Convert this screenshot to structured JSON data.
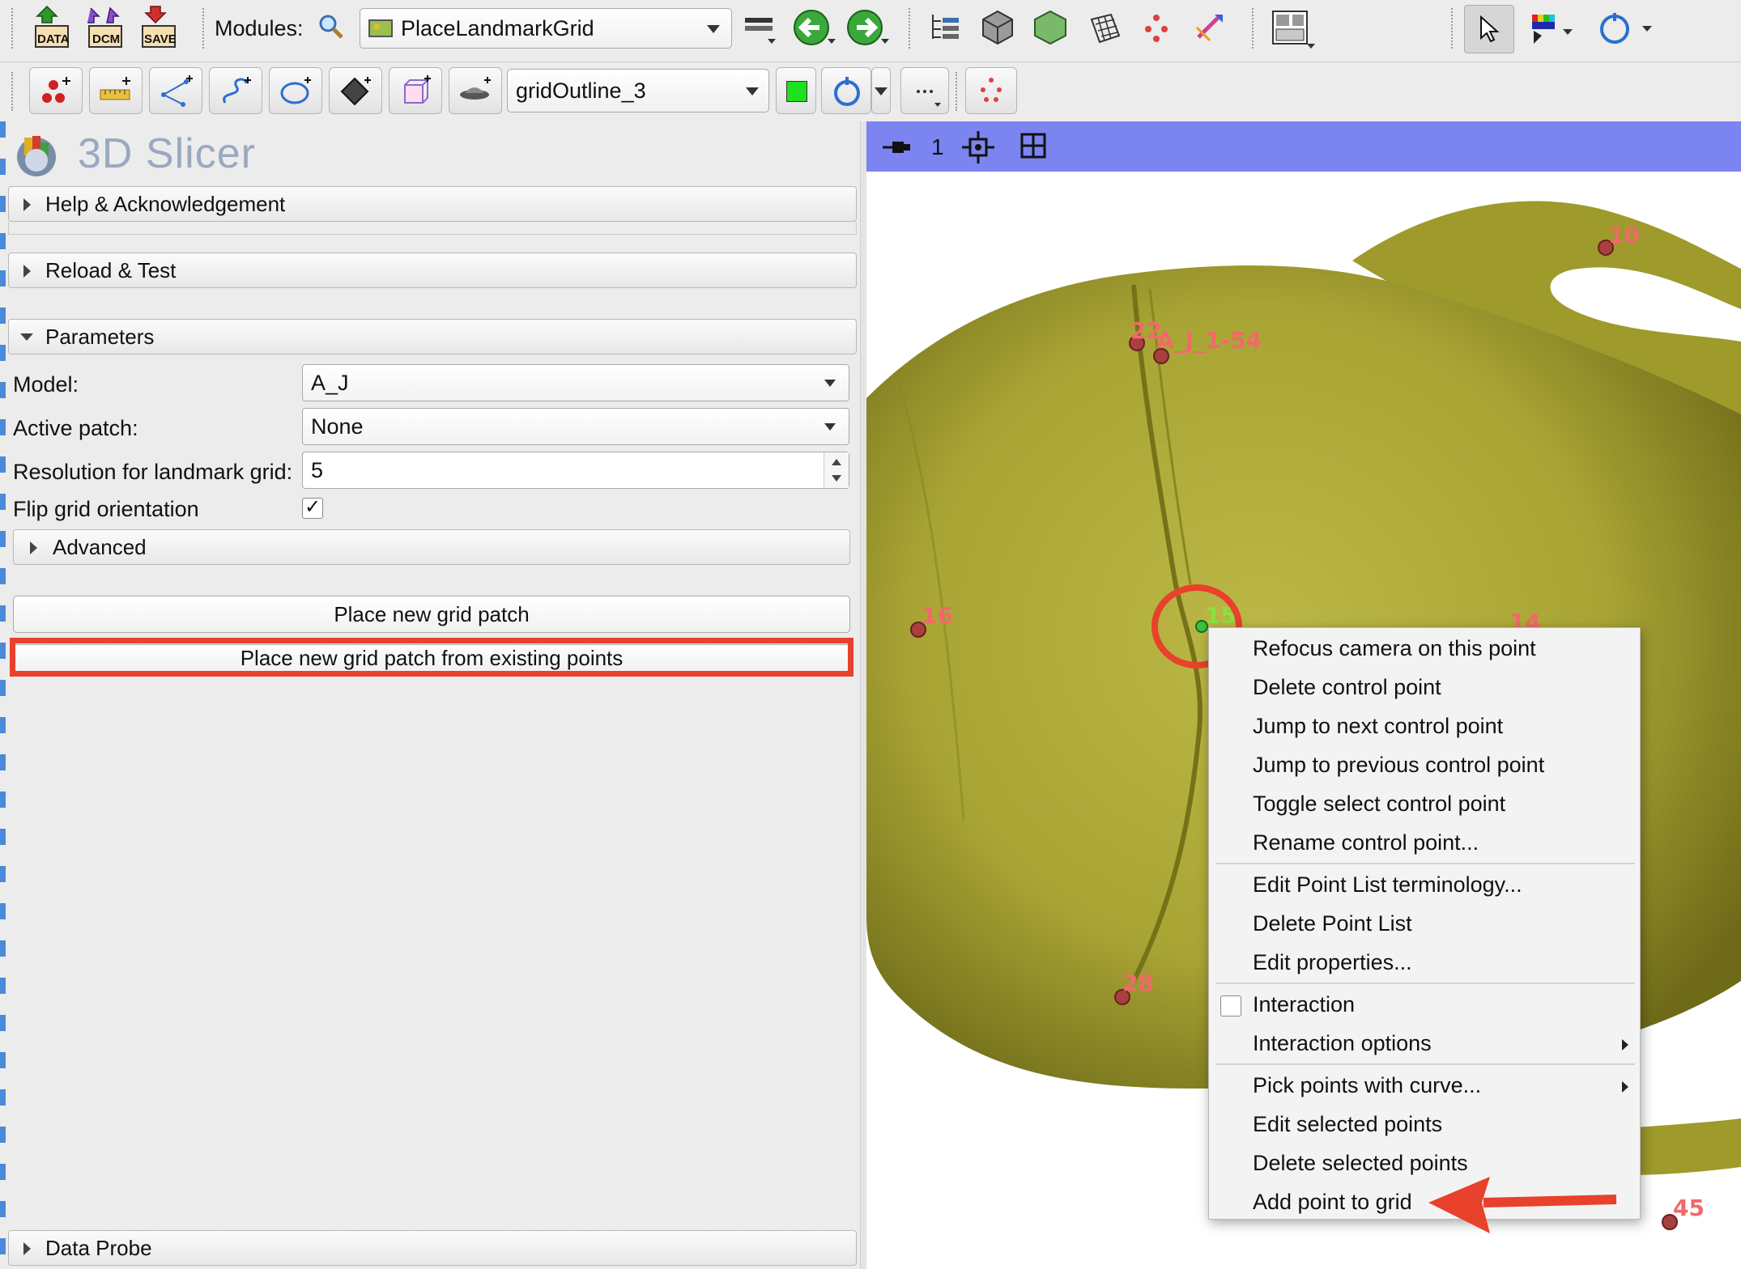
{
  "toolbar_top": {
    "data_label": "DATA",
    "dcm_label": "DCM",
    "save_label": "SAVE",
    "modules_label": "Modules:",
    "module_selected": "PlaceLandmarkGrid"
  },
  "toolbar_second": {
    "node_selected": "gridOutline_3"
  },
  "app": {
    "title": "3D Slicer"
  },
  "sections": {
    "help": "Help & Acknowledgement",
    "reload": "Reload & Test",
    "parameters": "Parameters",
    "advanced": "Advanced",
    "data_probe": "Data Probe"
  },
  "params": {
    "model_label": "Model:",
    "model_value": "A_J",
    "active_patch_label": "Active patch:",
    "active_patch_value": "None",
    "resolution_label": "Resolution for landmark grid:",
    "resolution_value": "5",
    "flip_label": "Flip grid orientation",
    "flip_checked": "✓"
  },
  "buttons": {
    "place_new": "Place new grid patch",
    "place_from_existing": "Place new grid patch from existing points"
  },
  "viewer": {
    "view_number": "1",
    "bar_color": "#7b84f0",
    "model_color": "#b3b03a"
  },
  "landmarks": {
    "l10": "10",
    "l22": "22",
    "l_model": "A_J_1-54",
    "l16": "16",
    "l15": "15",
    "l14": "14",
    "l28": "28",
    "l45": "45"
  },
  "context_menu": {
    "refocus": "Refocus camera on this point",
    "delete_cp": "Delete control point",
    "jump_next": "Jump to next control point",
    "jump_prev": "Jump to previous control point",
    "toggle_select": "Toggle select control point",
    "rename": "Rename control point...",
    "edit_terminology": "Edit Point List terminology...",
    "delete_list": "Delete Point List",
    "edit_props": "Edit properties...",
    "interaction": "Interaction",
    "interaction_options": "Interaction options",
    "pick_curve": "Pick points with curve...",
    "edit_selected": "Edit selected points",
    "delete_selected": "Delete selected points",
    "add_to_grid": "Add point to grid"
  },
  "annotations": {
    "highlight_color": "#e8412c"
  }
}
